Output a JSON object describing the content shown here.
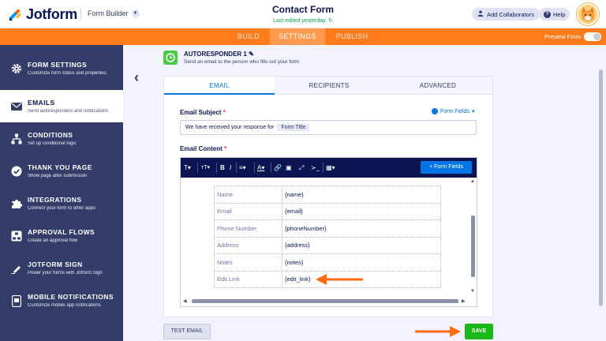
{
  "header": {
    "brand": "Jotform",
    "product": "Form Builder",
    "form_title": "Contact Form",
    "last_edited": "Last edited yesterday.",
    "add_collaborators": "Add Collaborators",
    "help": "Help"
  },
  "nav": {
    "tabs": [
      {
        "label": "BUILD",
        "active": false
      },
      {
        "label": "SETTINGS",
        "active": true
      },
      {
        "label": "PUBLISH",
        "active": false
      }
    ],
    "preview_form": "Preview Form"
  },
  "sidebar": {
    "items": [
      {
        "title": "FORM SETTINGS",
        "subtitle": "Customize form status and properties",
        "icon": "gear-icon"
      },
      {
        "title": "EMAILS",
        "subtitle": "Send autoresponders and notifications",
        "icon": "envelope-icon"
      },
      {
        "title": "CONDITIONS",
        "subtitle": "Set up conditional logic",
        "icon": "flowchart-icon"
      },
      {
        "title": "THANK YOU PAGE",
        "subtitle": "Show page after submission",
        "icon": "checkmark-circle-icon"
      },
      {
        "title": "INTEGRATIONS",
        "subtitle": "Connect your form to other apps",
        "icon": "puzzle-icon"
      },
      {
        "title": "APPROVAL FLOWS",
        "subtitle": "Create an approval flow",
        "icon": "approval-flow-icon"
      },
      {
        "title": "JOTFORM SIGN",
        "subtitle": "Power your forms with Jotform Sign",
        "icon": "pen-icon"
      },
      {
        "title": "MOBILE NOTIFICATIONS",
        "subtitle": "Customize mobile app notifications",
        "icon": "mobile-icon"
      }
    ],
    "active_index": 1
  },
  "autoresponder": {
    "title": "AUTORESPONDER 1",
    "subtitle": "Send an email to the person who fills out your form"
  },
  "email_tabs": [
    {
      "label": "EMAIL",
      "active": true
    },
    {
      "label": "RECIPIENTS",
      "active": false
    },
    {
      "label": "ADVANCED",
      "active": false
    }
  ],
  "subject": {
    "label": "Email Subject",
    "required_mark": "*",
    "form_fields": "Form Fields",
    "text": "We have received your response for",
    "chip": "Form Title"
  },
  "content": {
    "label": "Email Content",
    "required_mark": "*",
    "toolbar_form_fields": "+ Form Fields",
    "rows": [
      {
        "key": "Name",
        "value": "{name}"
      },
      {
        "key": "Email",
        "value": "{email}"
      },
      {
        "key": "Phone Number",
        "value": "{phoneNumber}"
      },
      {
        "key": "Address",
        "value": "{address}"
      },
      {
        "key": "Notes",
        "value": "{notes}"
      },
      {
        "key": "Edit Link",
        "value": "{edit_link}"
      }
    ]
  },
  "footer": {
    "test_email": "TEST EMAIL",
    "save": "SAVE"
  },
  "colors": {
    "orange": "#ff7b1c",
    "navy": "#0a1551",
    "sidebar": "#343c6a",
    "blue": "#0075e3",
    "green": "#18b918",
    "annotation": "#ff6a13"
  }
}
